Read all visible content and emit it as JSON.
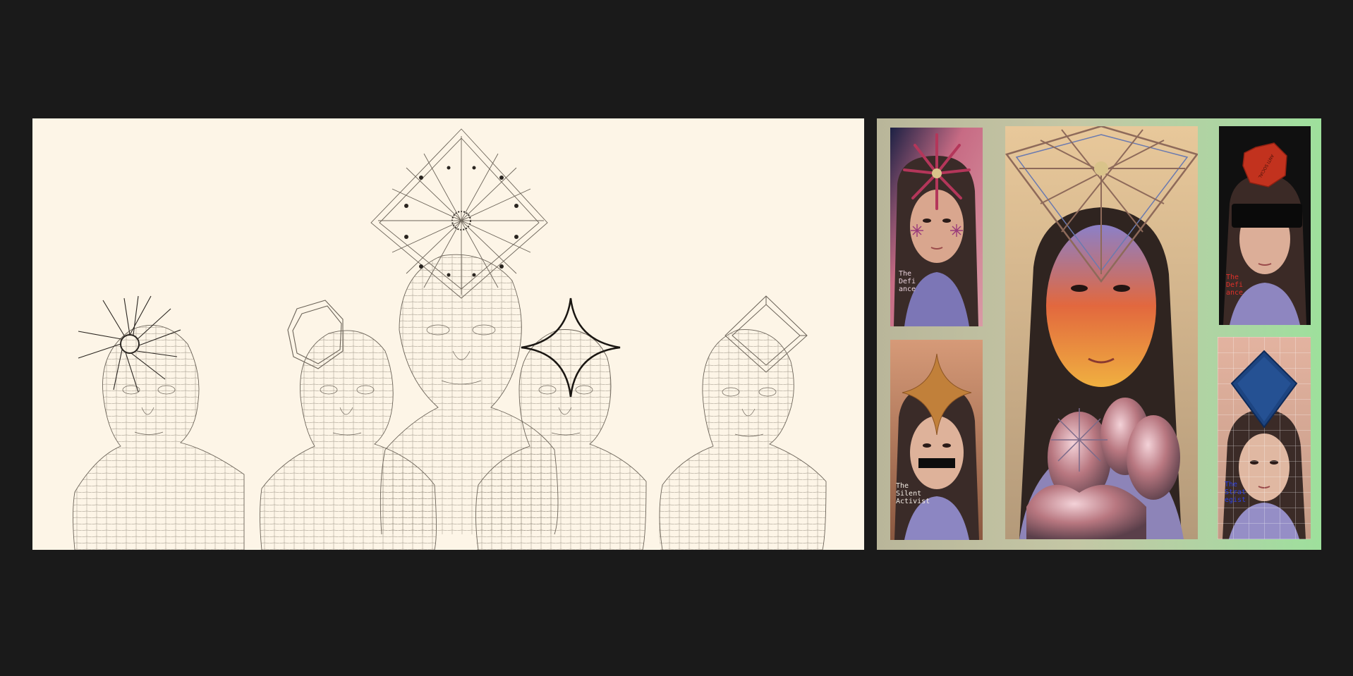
{
  "tiles": [
    {
      "id": "the-defiance-tl",
      "caption": "The\nDefi\nance",
      "caption_color": "#e9d2dc"
    },
    {
      "id": "the-silent-activist",
      "caption": "The\nSilent\nActivist",
      "caption_color": "#f3ece4"
    },
    {
      "id": "the-defiance-tr",
      "caption": "The\nDefi\nance",
      "caption_color": "#e0302a"
    },
    {
      "id": "the-strategist",
      "caption": "The\nStrat\negist",
      "caption_color": "#2b3fe0"
    }
  ],
  "colors": {
    "page_background": "#1a1a1a",
    "wireframe_panel": "#fdf5e7",
    "wire_stroke": "#6b6358"
  }
}
